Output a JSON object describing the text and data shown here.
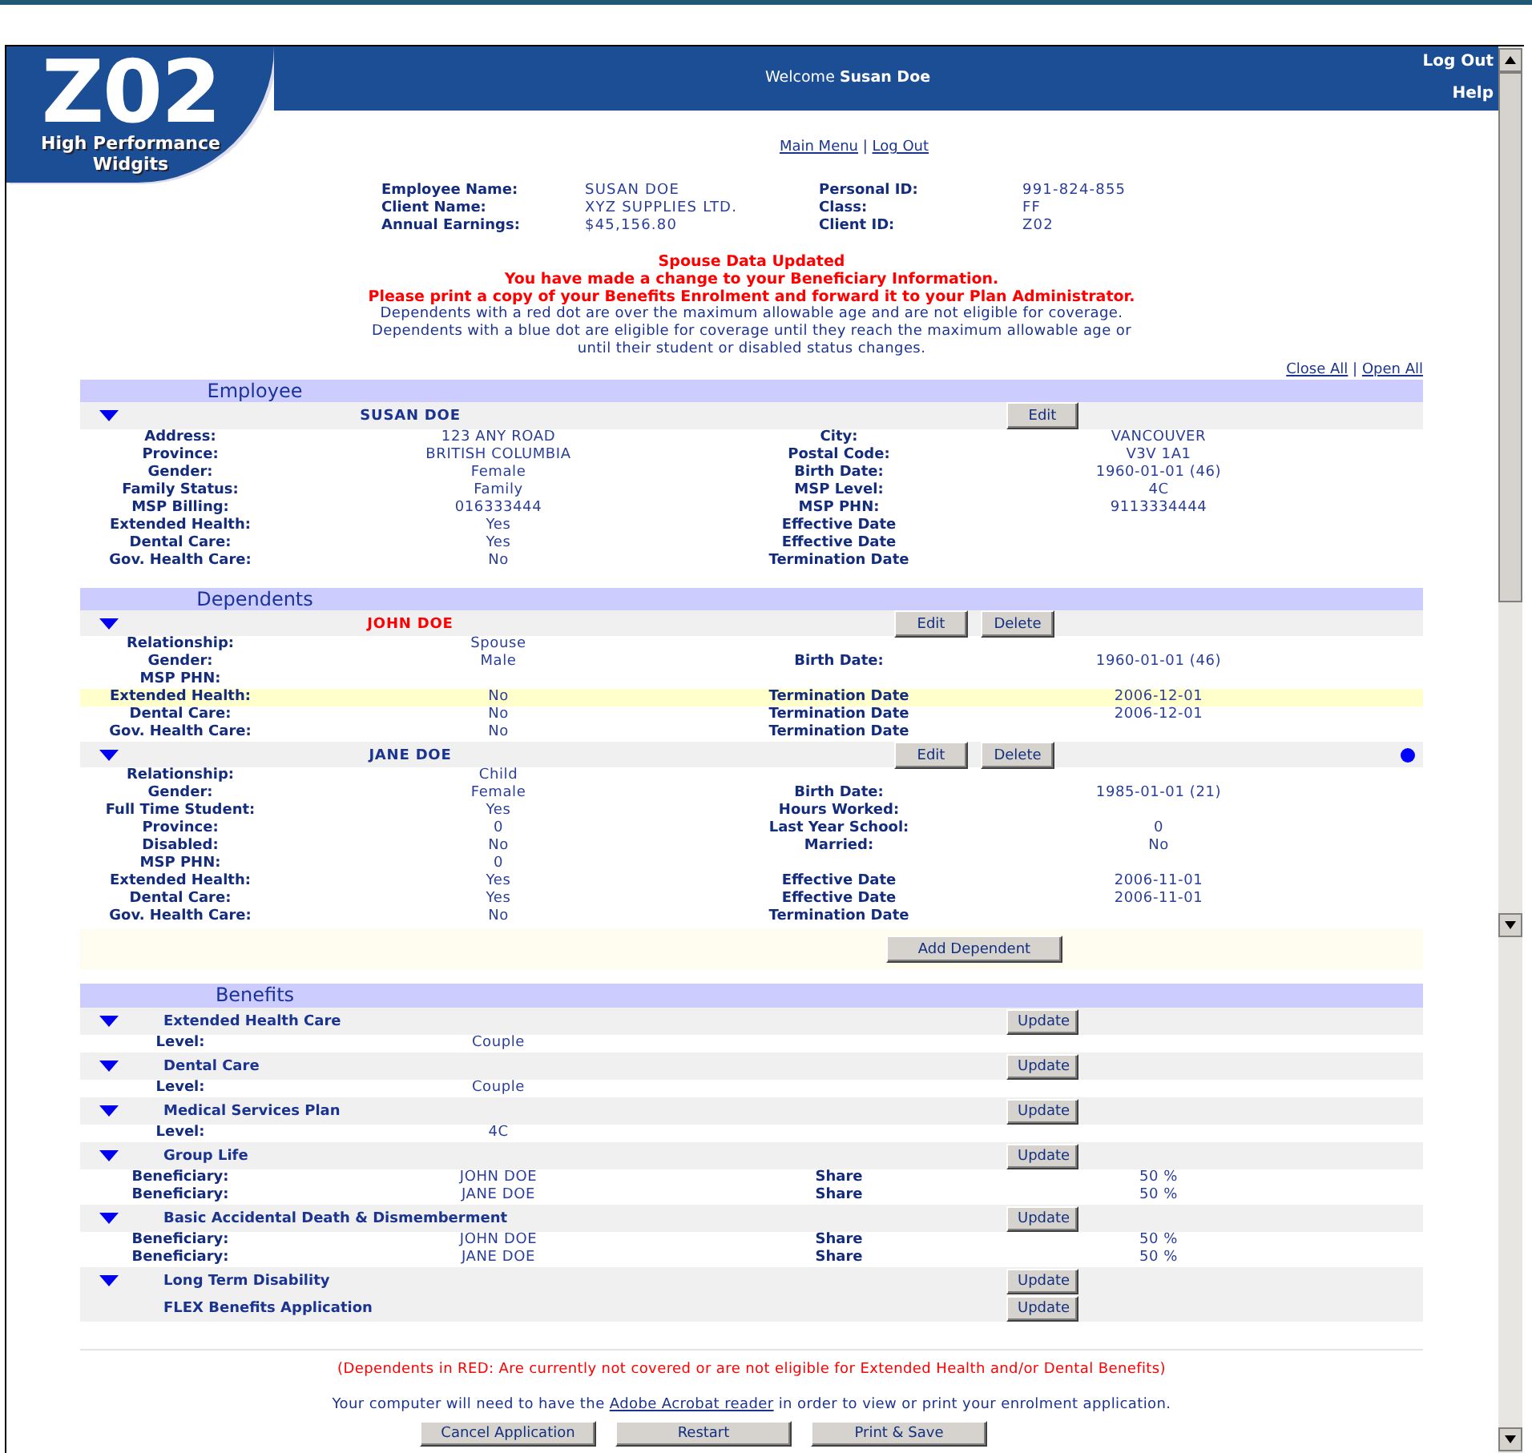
{
  "header": {
    "logo": {
      "code": "Z02",
      "tagline": "High Performance Widgits"
    },
    "welcome": "Welcome **Susan Doe**",
    "links": [
      "Log Out",
      "Help"
    ]
  },
  "nav": {
    "links": [
      "Main Menu",
      "Log Out"
    ],
    "separator": "|"
  },
  "summary": {
    "left": [
      {
        "label": "Employee Name:",
        "value": "SUSAN DOE"
      },
      {
        "label": "Client Name:",
        "value": "XYZ SUPPLIES LTD."
      },
      {
        "label": "Annual Earnings:",
        "value": "$45,156.80"
      }
    ],
    "right": [
      {
        "label": "Personal ID:",
        "value": "991-824-855"
      },
      {
        "label": "Class:",
        "value": "FF"
      },
      {
        "label": "Client ID:",
        "value": "Z02"
      }
    ]
  },
  "messages": {
    "alerts": [
      "Spouse Data Updated",
      "You have made a change to your Beneficiary Information.",
      "Please print a copy of your Benefits Enrolment and forward it to your Plan Administrator."
    ],
    "note": "Dependents with a red dot are over the maximum allowable age and are not eligible for coverage. Dependents with a blue dot are eligible for coverage until they reach the maximum allowable age or until their student or disabled status changes."
  },
  "toggle_links": {
    "links": [
      "Close All",
      "Open All"
    ],
    "separator": "|"
  },
  "employee": {
    "title": "Employee",
    "name": "SUSAN DOE",
    "buttons": [
      "Edit"
    ],
    "rows": [
      {
        "label": "Address:",
        "value": "123 ANY ROAD",
        "label2": "City:",
        "value2": "VANCOUVER"
      },
      {
        "label": "Province:",
        "value": "BRITISH COLUMBIA",
        "label2": "Postal Code:",
        "value2": "V3V 1A1"
      },
      {
        "label": "Gender:",
        "value": "Female",
        "label2": "Birth Date:",
        "value2": "1960-01-01 (46)"
      },
      {
        "label": "Family Status:",
        "value": "Family",
        "label2": "MSP Level:",
        "value2": "4C"
      },
      {
        "label": "MSP Billing:",
        "value": "016333444",
        "label2": "MSP PHN:",
        "value2": "9113334444"
      },
      {
        "label": "Extended Health:",
        "value": "Yes",
        "label2": "Effective Date"
      },
      {
        "label": "Dental Care:",
        "value": "Yes",
        "label2": "Effective Date"
      },
      {
        "label": "Gov. Health Care:",
        "value": "No",
        "label2": "Termination Date"
      }
    ]
  },
  "dependents": {
    "title": "Dependents",
    "people": [
      {
        "name": "JOHN DOE",
        "not_covered": true,
        "buttons": [
          "Edit",
          "Delete"
        ],
        "rows": [
          {
            "label": "Relationship:",
            "value": "Spouse",
            "highlighted": false
          },
          {
            "label": "Gender:",
            "value": "Male",
            "label2": "Birth Date:",
            "value2": "1960-01-01 (46)",
            "highlighted": false
          },
          {
            "label": "MSP PHN:",
            "highlighted": false
          },
          {
            "label": "Extended Health:",
            "value": "No",
            "label2": "Termination Date",
            "value2": "2006-12-01",
            "highlighted": true
          },
          {
            "label": "Dental Care:",
            "value": "No",
            "label2": "Termination Date",
            "value2": "2006-12-01",
            "highlighted": false
          },
          {
            "label": "Gov. Health Care:",
            "value": "No",
            "label2": "Termination Date",
            "highlighted": false
          }
        ]
      },
      {
        "name": "JANE DOE",
        "not_covered": false,
        "color": "#0000ff",
        "buttons": [
          "Edit",
          "Delete"
        ],
        "rows": [
          {
            "label": "Relationship:",
            "value": "Child",
            "highlighted": false
          },
          {
            "label": "Gender:",
            "value": "Female",
            "label2": "Birth Date:",
            "value2": "1985-01-01 (21)",
            "highlighted": false
          },
          {
            "label": "Full Time Student:",
            "value": "Yes",
            "label2": "Hours Worked:",
            "highlighted": false
          },
          {
            "label": "Province:",
            "value": "0",
            "label2": "Last Year School:",
            "value2": "0",
            "highlighted": false
          },
          {
            "label": "Disabled:",
            "value": "No",
            "label2": "Married:",
            "value2": "No",
            "highlighted": false
          },
          {
            "label": "MSP PHN:",
            "value": "0",
            "highlighted": false
          },
          {
            "label": "Extended Health:",
            "value": "Yes",
            "label2": "Effective Date",
            "value2": "2006-11-01",
            "highlighted": false
          },
          {
            "label": "Dental Care:",
            "value": "Yes",
            "label2": "Effective Date",
            "value2": "2006-11-01",
            "highlighted": false
          },
          {
            "label": "Gov. Health Care:",
            "value": "No",
            "label2": "Termination Date",
            "highlighted": false
          }
        ]
      }
    ],
    "add_button": "Add Dependent"
  },
  "benefits": {
    "title": "Benefits",
    "plans": [
      {
        "name": "Extended Health Care",
        "expandable": true,
        "button": "Update",
        "rows": [
          {
            "label": "Level:",
            "value": "Couple"
          }
        ]
      },
      {
        "name": "Dental Care",
        "expandable": true,
        "button": "Update",
        "rows": [
          {
            "label": "Level:",
            "value": "Couple"
          }
        ]
      },
      {
        "name": "Medical Services Plan",
        "expandable": true,
        "button": "Update",
        "rows": [
          {
            "label": "Level:",
            "value": "4C"
          }
        ]
      },
      {
        "name": "Group Life",
        "expandable": true,
        "button": "Update",
        "rows": [
          {
            "label": "Beneficiary:",
            "value": "JOHN DOE",
            "label2": "Share",
            "value2": "50 %"
          },
          {
            "label": "Beneficiary:",
            "value": "JANE DOE",
            "label2": "Share",
            "value2": "50 %"
          }
        ]
      },
      {
        "name": "Basic Accidental Death & Dismemberment",
        "expandable": true,
        "button": "Update",
        "rows": [
          {
            "label": "Beneficiary:",
            "value": "JOHN DOE",
            "label2": "Share",
            "value2": "50 %"
          },
          {
            "label": "Beneficiary:",
            "value": "JANE DOE",
            "label2": "Share",
            "value2": "50 %"
          }
        ]
      },
      {
        "name": "Long Term Disability",
        "expandable": true,
        "button": "Update"
      },
      {
        "name": "FLEX Benefits Application",
        "expandable": false,
        "button": "Update"
      }
    ]
  },
  "footer": {
    "note": "(Dependents in RED: Are currently not covered or are not eligible for Extended Health and/or Dental Benefits)",
    "requirement": {
      "before": "Your computer will need to have the",
      "link": "Adobe Acrobat reader",
      "after": "in order to view or print your enrolment application."
    },
    "buttons": [
      "Cancel Application",
      "Restart",
      "Print & Save"
    ]
  }
}
